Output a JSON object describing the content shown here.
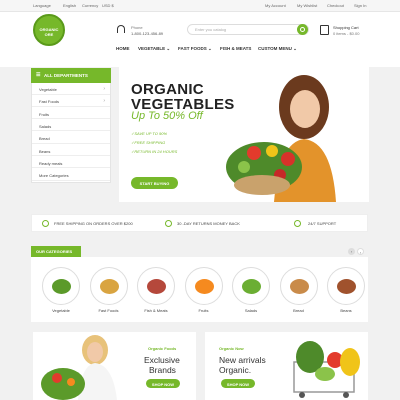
{
  "topbar": {
    "language_label": "Language",
    "language": "English",
    "currency_label": "Currency",
    "currency": "USD $",
    "links": [
      "My Account",
      "My Wishlist",
      "Checkout",
      "Sign In"
    ]
  },
  "logo": {
    "text": "ORGANIC ORE"
  },
  "contact": {
    "label": "Phone",
    "number": "1-800-123-456-89"
  },
  "search": {
    "placeholder": "Enter you catalog"
  },
  "cart": {
    "label": "Shopping Cart",
    "summary": "0 items - $0.00"
  },
  "nav": {
    "items": [
      "HOME",
      "VEGETABLE",
      "FAST FOODS",
      "FISH & MEATS",
      "CUSTOM MENU"
    ]
  },
  "sidebar": {
    "title": "ALL DEPARTMENTS",
    "items": [
      {
        "label": "Vegetable",
        "has_children": true
      },
      {
        "label": "Fast Foods",
        "has_children": true
      },
      {
        "label": "Fruits",
        "has_children": false
      },
      {
        "label": "Salads",
        "has_children": false
      },
      {
        "label": "Bread",
        "has_children": false
      },
      {
        "label": "Beans",
        "has_children": false
      },
      {
        "label": "Ready meals",
        "has_children": false
      },
      {
        "label": "More Categories",
        "has_children": false
      }
    ]
  },
  "hero": {
    "title_line1": "ORGANIC",
    "title_line2": "VEGETABLES",
    "subtitle": "Up To 50% Off",
    "features": [
      "✓SAVE UP TO 90%",
      "✓FREE SHIPPING",
      "✓RETURN IN 24 HOURS"
    ],
    "button": "START BUYING"
  },
  "shipping": {
    "items": [
      "FREE SHIPPING ON ORDERS OVER $200",
      "30 -DAY RETURNS MONEY BACK",
      "24/7 SUPPORT"
    ]
  },
  "categories": {
    "title": "OUR CATEGORIES",
    "items": [
      "Vegetable",
      "Fast Foods",
      "Fish & Meats",
      "Fruits",
      "Salads",
      "Bread",
      "Beans"
    ]
  },
  "banners": [
    {
      "small": "Organic Foods",
      "title_line1": "Exclusive",
      "title_line2": "Brands",
      "button": "SHOP NOW"
    },
    {
      "small": "Organic Now",
      "title_line1": "New arrivals",
      "title_line2": "Organic.",
      "button": "SHOP NOW"
    }
  ],
  "colors": {
    "accent": "#76b82a",
    "text": "#333333"
  }
}
